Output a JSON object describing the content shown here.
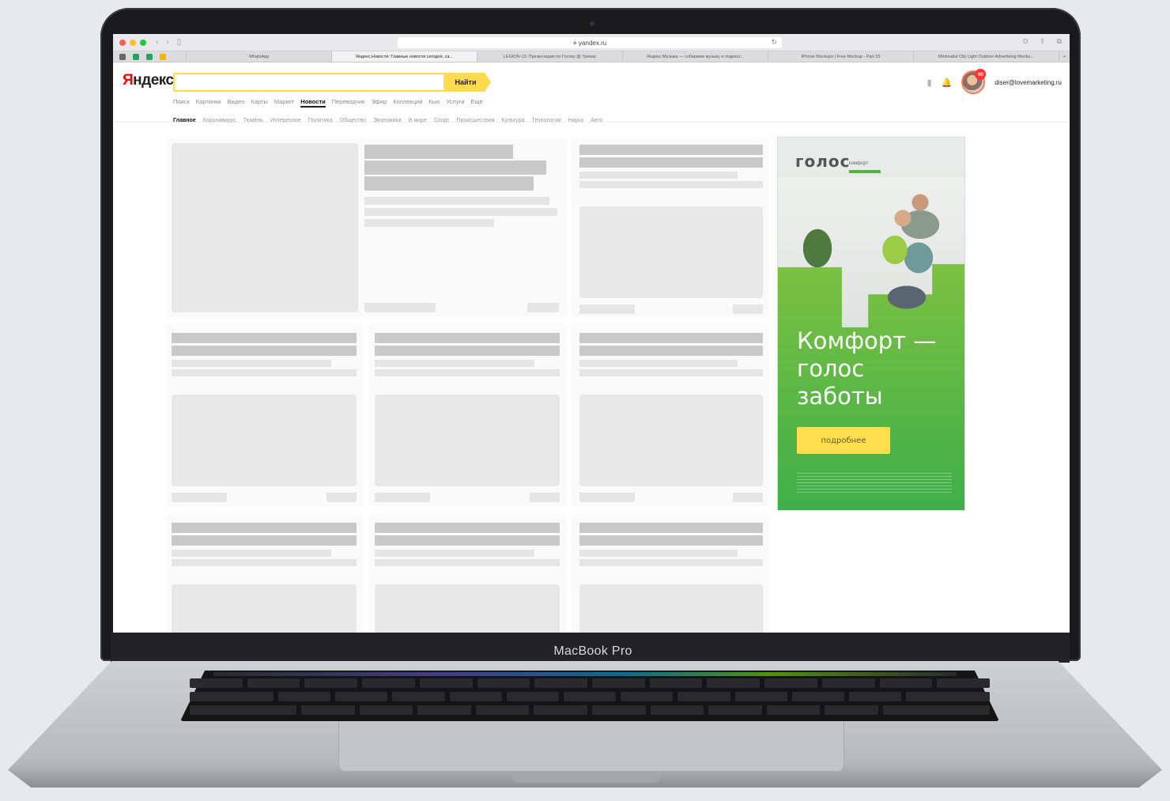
{
  "device": {
    "label": "MacBook Pro"
  },
  "browser": {
    "address": "yandex.ru",
    "address_lock": "⋄",
    "tabs": [
      "WhatsApp",
      "Яндекс.Новости: Главные новости сегодня, са...",
      "LEGION-13: Презентация по Госоку @ Трекер",
      "Яндекс.Музыка — собираем музыку и подкаст...",
      "iPhone Mockups | Free Mockup - Part 15",
      "Minimalist City Light Outdoor Advertising Mocku..."
    ]
  },
  "yandex": {
    "logo_first": "Я",
    "logo_rest": "ндекс",
    "search_value": "",
    "search_button": "Найти",
    "services": [
      "Поиск",
      "Картинки",
      "Видео",
      "Карты",
      "Маркет",
      "Новости",
      "Переводчик",
      "Эфир",
      "Коллекции",
      "Кью",
      "Услуги",
      "Ещё"
    ],
    "active_service": "Новости",
    "categories": [
      "Главное",
      "Коронавирус",
      "Тюмень",
      "Интересное",
      "Политика",
      "Общество",
      "Экономика",
      "В мире",
      "Спорт",
      "Происшествия",
      "Культура",
      "Технологии",
      "Наука",
      "Авто"
    ],
    "active_category": "Главное",
    "user_email": "diser@lovemarketing.ru",
    "notification_count": "90"
  },
  "ad": {
    "brand": "голос",
    "brand_sub": "комфорт",
    "headline": "Комфорт — голос заботы",
    "button": "подробнее",
    "colors": {
      "green": "#3fae49",
      "yellow": "#ffdf4d"
    }
  },
  "colors": {
    "search_yellow": "#ffdb4d",
    "logo_red": "#ff0000"
  }
}
